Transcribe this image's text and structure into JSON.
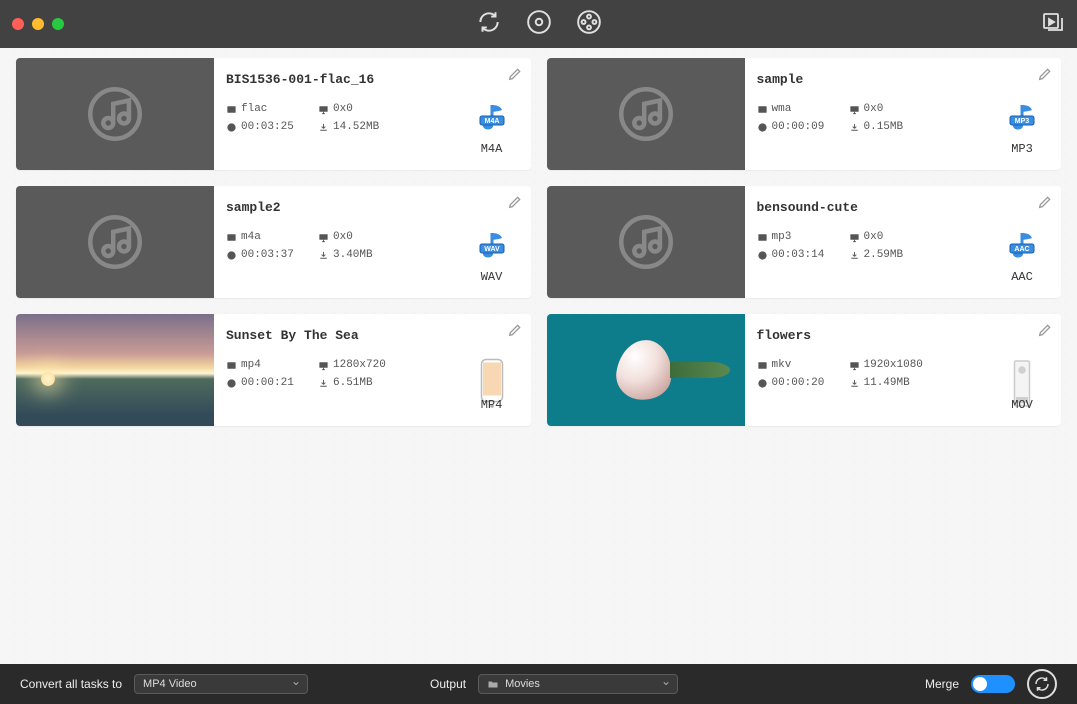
{
  "items": [
    {
      "title": "BIS1536-001-flac_16",
      "codec": "flac",
      "dim": "0x0",
      "dur": "00:03:25",
      "size": "14.52MB",
      "fmt": "M4A",
      "thumb": "music"
    },
    {
      "title": "sample",
      "codec": "wma",
      "dim": "0x0",
      "dur": "00:00:09",
      "size": "0.15MB",
      "fmt": "MP3",
      "thumb": "music"
    },
    {
      "title": "sample2",
      "codec": "m4a",
      "dim": "0x0",
      "dur": "00:03:37",
      "size": "3.40MB",
      "fmt": "WAV",
      "thumb": "music"
    },
    {
      "title": "bensound-cute",
      "codec": "mp3",
      "dim": "0x0",
      "dur": "00:03:14",
      "size": "2.59MB",
      "fmt": "AAC",
      "thumb": "music"
    },
    {
      "title": "Sunset By The Sea",
      "codec": "mp4",
      "dim": "1280x720",
      "dur": "00:00:21",
      "size": "6.51MB",
      "fmt": "MP4",
      "thumb": "sunset"
    },
    {
      "title": "flowers",
      "codec": "mkv",
      "dim": "1920x1080",
      "dur": "00:00:20",
      "size": "11.49MB",
      "fmt": "MOV",
      "thumb": "flower"
    }
  ],
  "bottom": {
    "convert_label": "Convert all tasks to",
    "convert_sel": "MP4 Video",
    "output_label": "Output",
    "output_sel": "Movies",
    "merge_label": "Merge"
  },
  "colors": {
    "M4A": "#3a8de0",
    "MP3": "#3a8de0",
    "WAV": "#3a8de0",
    "AAC": "#3a8de0"
  }
}
